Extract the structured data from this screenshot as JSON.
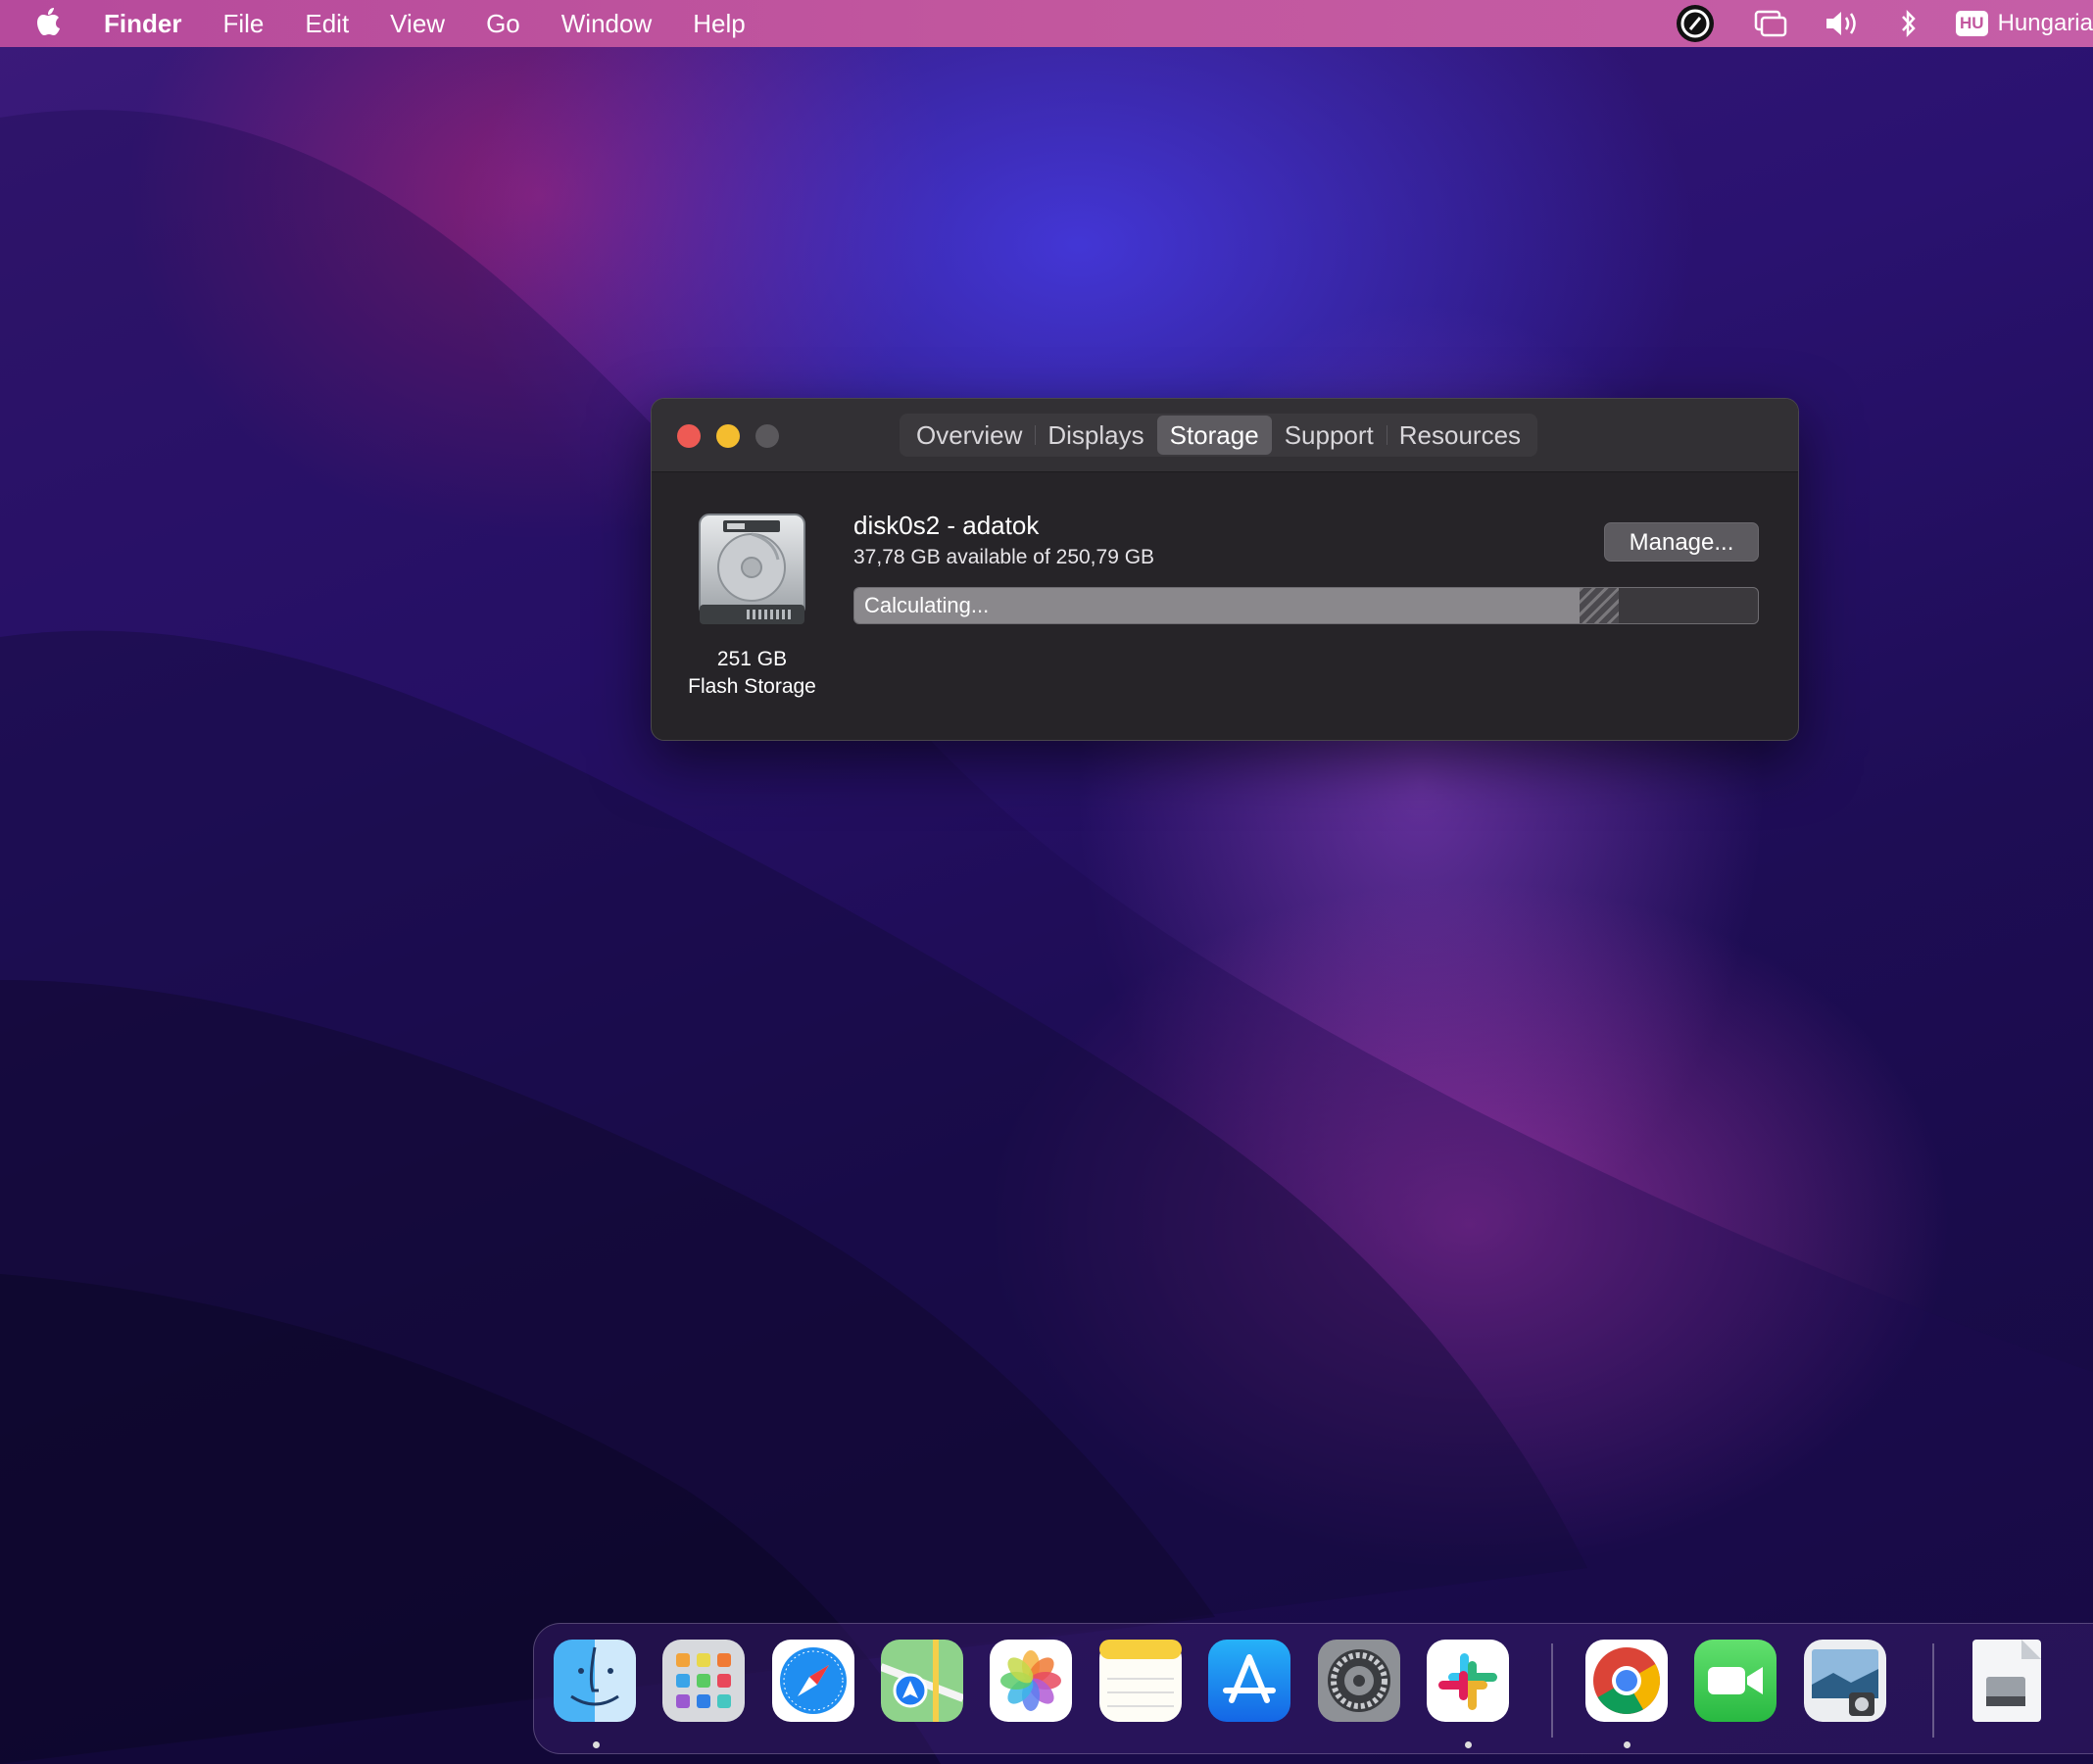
{
  "menubar": {
    "app_name": "Finder",
    "menus": [
      "File",
      "Edit",
      "View",
      "Go",
      "Window",
      "Help"
    ],
    "input_source_badge": "HU",
    "input_source_label": "Hungaria"
  },
  "window": {
    "tabs": [
      "Overview",
      "Displays",
      "Storage",
      "Support",
      "Resources"
    ],
    "active_tab": "Storage",
    "disk": {
      "size": "251 GB",
      "type": "Flash Storage",
      "volume_name": "disk0s2 - adatok",
      "availability": "37,78 GB available of 250,79 GB",
      "usage_fraction": 0.803,
      "bar_label": "Calculating..."
    },
    "manage_label": "Manage..."
  },
  "dock": {
    "items": [
      {
        "name": "finder-icon",
        "running": true
      },
      {
        "name": "launchpad-icon",
        "running": false
      },
      {
        "name": "safari-icon",
        "running": false
      },
      {
        "name": "maps-icon",
        "running": false
      },
      {
        "name": "photos-icon",
        "running": false
      },
      {
        "name": "notes-icon",
        "running": false
      },
      {
        "name": "app-store-icon",
        "running": false
      },
      {
        "name": "system-preferences-icon",
        "running": false
      },
      {
        "name": "slack-icon",
        "running": true
      },
      {
        "name": "chrome-icon",
        "running": true
      },
      {
        "name": "facetime-icon",
        "running": false
      },
      {
        "name": "preview-icon",
        "running": false
      },
      {
        "name": "document-icon",
        "running": false
      }
    ]
  },
  "colors": {
    "close": "#ee5a54",
    "minimize": "#f4bd2f",
    "zoom_disabled": "#5a585c",
    "menubar": "#c2579e"
  }
}
